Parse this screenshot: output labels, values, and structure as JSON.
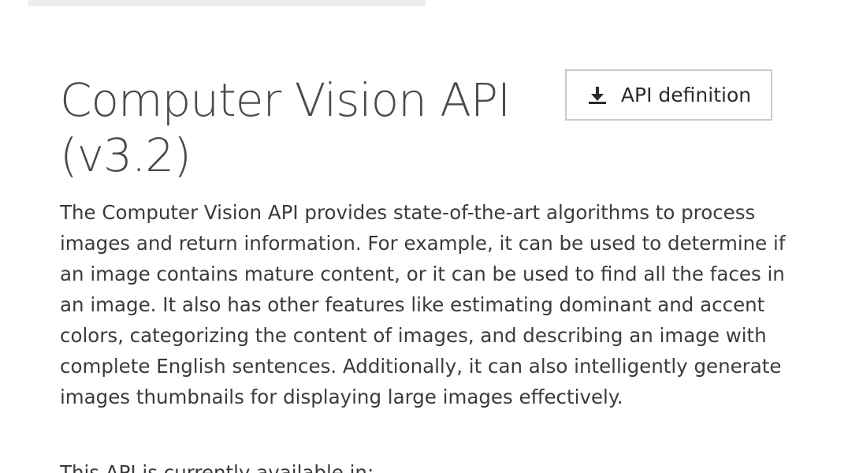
{
  "header": {
    "title": "Computer Vision API (v3.2)",
    "api_definition_button": {
      "label": "API definition",
      "icon": "download-icon"
    }
  },
  "content": {
    "description": "The Computer Vision API provides state-of-the-art algorithms to process images and return information. For example, it can be used to determine if an image contains mature content, or it can be used to find all the faces in an image. It also has other features like estimating dominant and accent colors, categorizing the content of images, and describing an image with complete English sentences. Additionally, it can also intelligently generate images thumbnails for displaying large images effectively.",
    "availability_text": "This API is currently available in:"
  },
  "colors": {
    "text": "#3b3b3b",
    "title": "#4a4a4a",
    "button_border": "#c8c8c8",
    "top_bar": "#eeeeee"
  }
}
